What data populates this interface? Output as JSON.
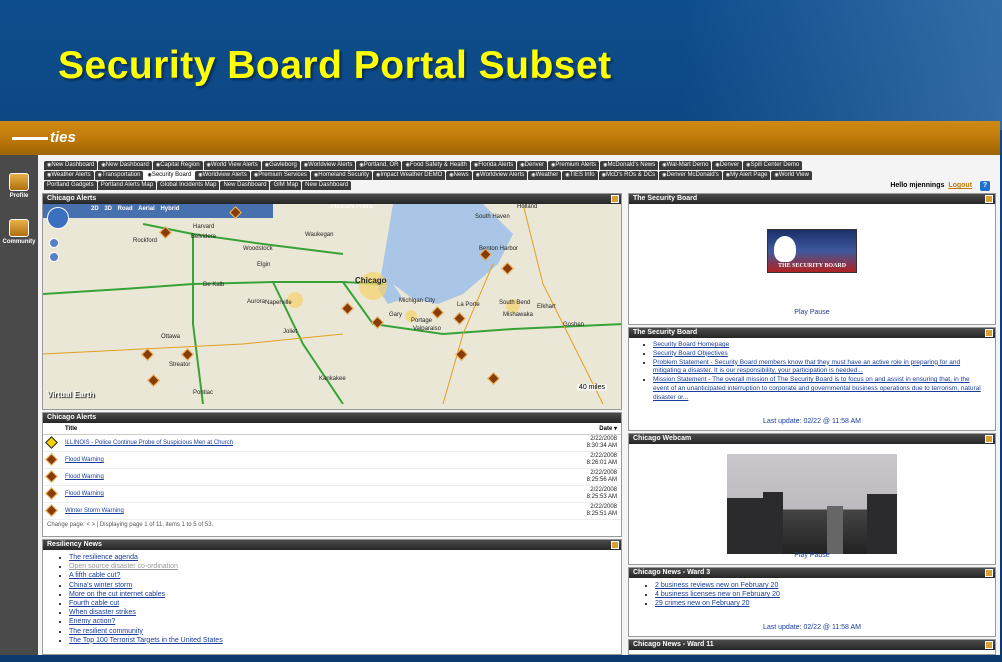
{
  "slide": {
    "title": "Security Board Portal Subset"
  },
  "logo": {
    "text": "ties"
  },
  "rail": {
    "profile": "Profile",
    "community": "Community"
  },
  "tabs": {
    "row1": [
      "New Dashboard",
      "New Dashboard",
      "Capital Region",
      "World View Alerts",
      "Gavleborg",
      "Worldview Alerts",
      "Portland, OR",
      "Food Safety & Health",
      "Florida Alerts",
      "Denver",
      "Premium Alerts",
      "McDonald's News",
      "Wal-Mart Demo",
      "Denver",
      "Spill Center Demo"
    ],
    "row2": [
      "Weather Alerts",
      "Transportation",
      "Security Board",
      "Worldview Alerts",
      "Premium Services",
      "Homeland Security",
      "Impact Weather DEMO",
      "News",
      "Worldview Alerts",
      "Weather",
      "TIES Info",
      "McD's ROs & DCs",
      "Denver McDonald's",
      "My Alert Page",
      "World View"
    ],
    "row3": [
      "Portland Gadgets",
      "Portland Alerts Map",
      "Global Incidents Map",
      "New Dashboard",
      "GIM Map",
      "New Dashboard"
    ],
    "active": "Security Board"
  },
  "header": {
    "hello": "Hello mjennings",
    "logout": "Logout",
    "help": "?"
  },
  "map_panel": {
    "title": "Chicago Alerts",
    "modes": "2D 3D Road Aerial Hybrid",
    "brand": "Virtual Earth",
    "scale": "40 miles",
    "labels": {
      "chicago": "Chicago",
      "rockford": "Rockford",
      "aurora": "Aurora",
      "joliet": "Joliet",
      "gary": "Gary",
      "elgin": "Elgin",
      "naperville": "Naperville",
      "waukegan": "Waukegan",
      "south_bend": "South Bend",
      "kankakee": "Kankakee",
      "michigan_city": "Michigan City",
      "valparaiso": "Valparaiso",
      "portage": "Portage",
      "mishawaka": "Mishawaka",
      "dekalb": "De Kalb",
      "woodstock": "Woodstock",
      "belvidere": "Belvidere",
      "harvard": "Harvard",
      "kenosha": "Pleasant Prairie",
      "pontiac": "Pontiac",
      "ottawa": "Ottawa",
      "streator": "Streator",
      "la_porte": "La Porte",
      "goshen": "Goshen",
      "elkhart": "Elkhart",
      "benton_harbor": "Benton Harbor",
      "south_haven": "South Haven",
      "holland": "Holland"
    }
  },
  "alerts_panel": {
    "title": "Chicago Alerts",
    "col_title": "Title",
    "col_date": "Date",
    "rows": [
      {
        "icon": "warning-icon",
        "title": "ILLINOIS - Police Continue Probe of Suspicious Men at Church",
        "date": "2/22/2008\n8:30:34 AM"
      },
      {
        "icon": "flood-icon",
        "title": "Flood Warning",
        "date": "2/22/2008\n8:26:01 AM"
      },
      {
        "icon": "flood-icon",
        "title": "Flood Warning",
        "date": "2/22/2008\n8:25:56 AM"
      },
      {
        "icon": "flood-icon",
        "title": "Flood Warning",
        "date": "2/22/2008\n8:25:53 AM"
      },
      {
        "icon": "storm-icon",
        "title": "Winter Storm Warning",
        "date": "2/22/2008\n8:25:51 AM"
      }
    ],
    "pager": "Change page: < > | Displaying page 1 of 11, items 1 to 5 of 53."
  },
  "resiliency_panel": {
    "title": "Resiliency News",
    "items": [
      {
        "text": "The resilience agenda",
        "dim": false
      },
      {
        "text": "Open source disaster co-ordination",
        "dim": true
      },
      {
        "text": "A fifth cable cut?",
        "dim": false
      },
      {
        "text": "China's winter storm",
        "dim": false
      },
      {
        "text": "More on the cut internet cables",
        "dim": false
      },
      {
        "text": "Fourth cable cut",
        "dim": false
      },
      {
        "text": "When disaster strikes",
        "dim": false
      },
      {
        "text": "Enemy action?",
        "dim": false
      },
      {
        "text": "The resilient community",
        "dim": false
      },
      {
        "text": "The Top 100 Terrorist Targets in the United States",
        "dim": false
      }
    ]
  },
  "security_board_image": {
    "title": "The Security Board",
    "caption": "THE SECURITY BOARD",
    "controls": "Play Pause"
  },
  "security_board_links": {
    "title": "The Security Board",
    "items": [
      "Security Board Homepage",
      "Security Board Objectives",
      "Problem Statement - Security Board members know that they must have an active role in preparing for and mitigating a disaster. It is our responsibility, your participation is needed...",
      "Mission Statement - The overall mission of The Security Board is to focus on and assist in ensuring that, in the event of an unanticipated interruption to corporate and governmental business operations due to terrorism, natural disaster or..."
    ],
    "last_update": "Last update: 02/22 @ 11:58 AM"
  },
  "webcam_panel": {
    "title": "Chicago Webcam",
    "controls": "Play Pause"
  },
  "news_ward3": {
    "title": "Chicago News - Ward 3",
    "items": [
      "2 business reviews new on February 20",
      "4 business licenses new on February 20",
      "29 crimes new on February 20"
    ],
    "last_update": "Last update: 02/22 @ 11:58 AM"
  },
  "news_ward11": {
    "title": "Chicago News - Ward 11"
  }
}
